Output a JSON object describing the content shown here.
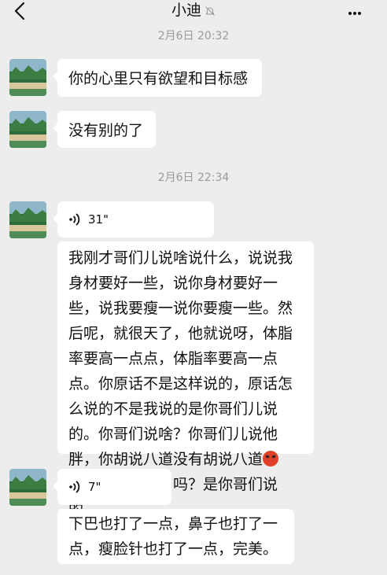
{
  "header": {
    "title": "小迪",
    "back_icon": "chevron-left-icon",
    "mute_icon": "bell-off-icon",
    "more_icon": "more-dots-icon"
  },
  "messages": [
    {
      "timestamp": "2月6日 20:32"
    },
    {
      "type": "text",
      "text": "你的心里只有欲望和目标感"
    },
    {
      "type": "text",
      "text": "没有别的了"
    },
    {
      "timestamp": "2月6日 22:34"
    },
    {
      "type": "voice",
      "duration": "31\""
    },
    {
      "type": "text",
      "lines": [
        "我刚才哥们儿说啥说什么，说说我",
        "身材要好一些，说你身材要好一",
        "些，说我要瘦一说你要瘦一些。然",
        "后呢，就很天了，他就说呀，体脂",
        "率要高一点点，体脂率要高一点",
        "点。你原话不是这样说的，原话怎",
        "么说的不是我说的是你哥们儿说",
        "的。你哥们说啥？你哥们儿说他",
        "胖，你胡说八道没有胡说八道",
        "，你不说他要出吗？是你哥们说的。"
      ],
      "emoji": "angry-face-emoji"
    },
    {
      "type": "voice",
      "duration": "7\""
    },
    {
      "type": "text",
      "lines": [
        "下巴也打了一点，鼻子也打了一",
        "点，瘦脸针也打了一点，完美。"
      ]
    }
  ],
  "colors": {
    "background": "#ededed",
    "bubble": "#ffffff",
    "timestamp": "#9a9a9a"
  }
}
